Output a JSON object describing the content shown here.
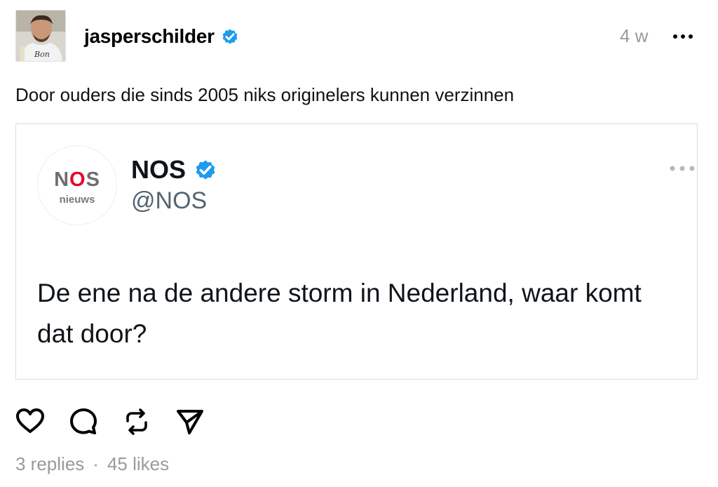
{
  "post": {
    "username": "jasperschilder",
    "timestamp": "4 w",
    "caption": "Door ouders die sinds 2005 niks originelers kunnen verzinnen",
    "avatar_shirt_text": "Bon"
  },
  "embed": {
    "logo_text_n": "N",
    "logo_text_o": "O",
    "logo_text_s": "S",
    "logo_subtext": "nieuws",
    "name": "NOS",
    "handle": "@NOS",
    "text": "De ene na de andere storm in Nederland, waar komt dat door?"
  },
  "stats": {
    "replies": "3 replies",
    "separator": "·",
    "likes": "45 likes"
  },
  "icons": {
    "verified": "verified-badge-icon",
    "more": "more-dots-icon",
    "like": "heart-icon",
    "reply": "comment-bubble-icon",
    "repost": "repost-icon",
    "share": "send-icon"
  },
  "colors": {
    "verified_blue": "#1d9bf0",
    "nos_red": "#e4032e",
    "muted_text": "#9a9a9a"
  }
}
